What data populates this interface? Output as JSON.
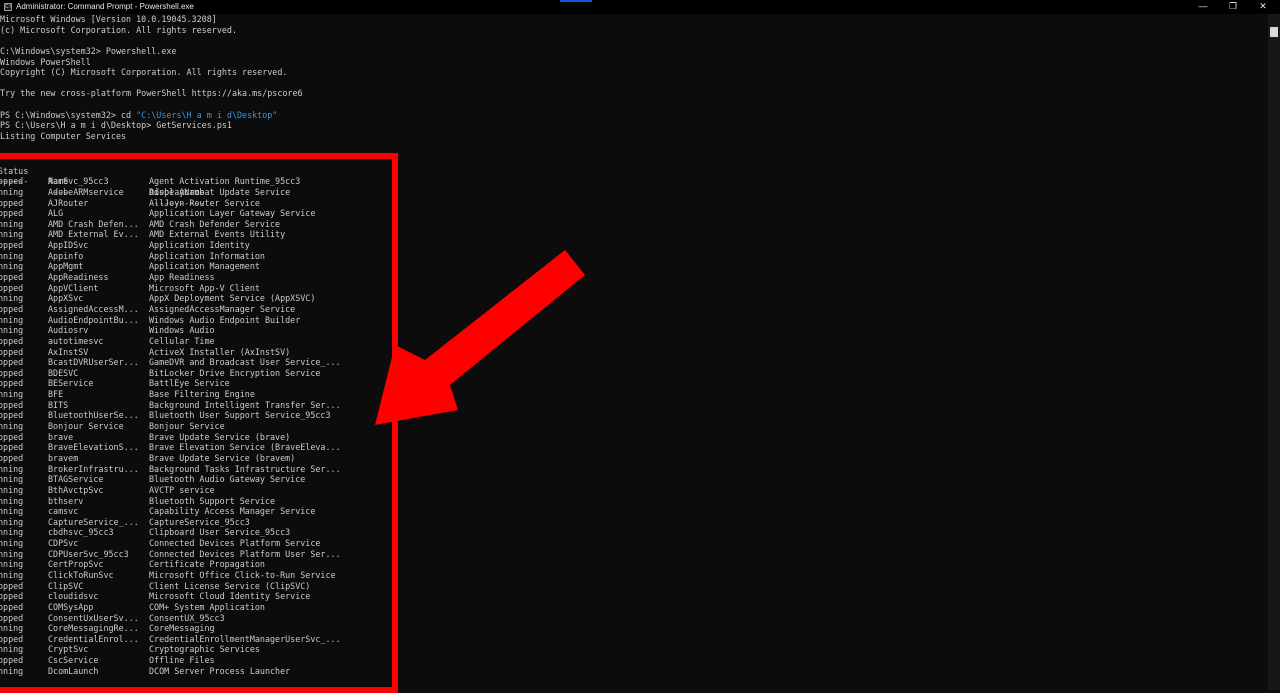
{
  "window": {
    "title": "Administrator: Command Prompt - Powershell.exe",
    "app_icon_glyph": "C:\\",
    "minimize_glyph": "—",
    "maximize_glyph": "❐",
    "close_glyph": "✕"
  },
  "terminal": {
    "lines": [
      "Microsoft Windows [Version 10.0.19045.3208]",
      "(c) Microsoft Corporation. All rights reserved.",
      "",
      "C:\\Windows\\system32> Powershell.exe",
      "Windows PowerShell",
      "Copyright (C) Microsoft Corporation. All rights reserved.",
      "",
      "Try the new cross-platform PowerShell https://aka.ms/pscore6",
      "",
      "PS C:\\Windows\\system32> cd ",
      "PS C:\\Users\\H a m i d\\Desktop> GetServices.ps1",
      "Listing Computer Services"
    ],
    "cd_path": "\"C:\\Users\\H a m i d\\Desktop\"",
    "headers": {
      "status": "Status",
      "name": "Name",
      "display": "DisplayName"
    },
    "separators": {
      "status": "------",
      "name": "----",
      "display": "-----------"
    },
    "services": [
      [
        "opped",
        "AarSvc_95cc3",
        "Agent Activation Runtime_95cc3"
      ],
      [
        "nning",
        "AdobeARMservice",
        "Adobe Acrobat Update Service"
      ],
      [
        "opped",
        "AJRouter",
        "AllJoyn Router Service"
      ],
      [
        "opped",
        "ALG",
        "Application Layer Gateway Service"
      ],
      [
        "nning",
        "AMD Crash Defen...",
        "AMD Crash Defender Service"
      ],
      [
        "nning",
        "AMD External Ev...",
        "AMD External Events Utility"
      ],
      [
        "opped",
        "AppIDSvc",
        "Application Identity"
      ],
      [
        "nning",
        "Appinfo",
        "Application Information"
      ],
      [
        "nning",
        "AppMgmt",
        "Application Management"
      ],
      [
        "opped",
        "AppReadiness",
        "App Readiness"
      ],
      [
        "opped",
        "AppVClient",
        "Microsoft App-V Client"
      ],
      [
        "nning",
        "AppXSvc",
        "AppX Deployment Service (AppXSVC)"
      ],
      [
        "opped",
        "AssignedAccessM...",
        "AssignedAccessManager Service"
      ],
      [
        "nning",
        "AudioEndpointBu...",
        "Windows Audio Endpoint Builder"
      ],
      [
        "nning",
        "Audiosrv",
        "Windows Audio"
      ],
      [
        "opped",
        "autotimesvc",
        "Cellular Time"
      ],
      [
        "opped",
        "AxInstSV",
        "ActiveX Installer (AxInstSV)"
      ],
      [
        "opped",
        "BcastDVRUserSer...",
        "GameDVR and Broadcast User Service_..."
      ],
      [
        "opped",
        "BDESVC",
        "BitLocker Drive Encryption Service"
      ],
      [
        "opped",
        "BEService",
        "BattlEye Service"
      ],
      [
        "nning",
        "BFE",
        "Base Filtering Engine"
      ],
      [
        "opped",
        "BITS",
        "Background Intelligent Transfer Ser..."
      ],
      [
        "opped",
        "BluetoothUserSe...",
        "Bluetooth User Support Service_95cc3"
      ],
      [
        "nning",
        "Bonjour Service",
        "Bonjour Service"
      ],
      [
        "opped",
        "brave",
        "Brave Update Service (brave)"
      ],
      [
        "opped",
        "BraveElevationS...",
        "Brave Elevation Service (BraveEleva..."
      ],
      [
        "opped",
        "bravem",
        "Brave Update Service (bravem)"
      ],
      [
        "nning",
        "BrokerInfrastru...",
        "Background Tasks Infrastructure Ser..."
      ],
      [
        "nning",
        "BTAGService",
        "Bluetooth Audio Gateway Service"
      ],
      [
        "nning",
        "BthAvctpSvc",
        "AVCTP service"
      ],
      [
        "nning",
        "bthserv",
        "Bluetooth Support Service"
      ],
      [
        "nning",
        "camsvc",
        "Capability Access Manager Service"
      ],
      [
        "nning",
        "CaptureService_...",
        "CaptureService_95cc3"
      ],
      [
        "nning",
        "cbdhsvc_95cc3",
        "Clipboard User Service_95cc3"
      ],
      [
        "nning",
        "CDPSvc",
        "Connected Devices Platform Service"
      ],
      [
        "nning",
        "CDPUserSvc_95cc3",
        "Connected Devices Platform User Ser..."
      ],
      [
        "nning",
        "CertPropSvc",
        "Certificate Propagation"
      ],
      [
        "nning",
        "ClickToRunSvc",
        "Microsoft Office Click-to-Run Service"
      ],
      [
        "opped",
        "ClipSVC",
        "Client License Service (ClipSVC)"
      ],
      [
        "opped",
        "cloudidsvc",
        "Microsoft Cloud Identity Service"
      ],
      [
        "opped",
        "COMSysApp",
        "COM+ System Application"
      ],
      [
        "opped",
        "ConsentUxUserSv...",
        "ConsentUX_95cc3"
      ],
      [
        "nning",
        "CoreMessagingRe...",
        "CoreMessaging"
      ],
      [
        "opped",
        "CredentialEnrol...",
        "CredentialEnrollmentManagerUserSvc_..."
      ],
      [
        "nning",
        "CryptSvc",
        "Cryptographic Services"
      ],
      [
        "opped",
        "CscService",
        "Offline Files"
      ],
      [
        "nning",
        "DcomLaunch",
        "DCOM Server Process Launcher"
      ]
    ]
  },
  "colors": {
    "terminal_bg": "#0c0c0c",
    "text": "#cccccc",
    "path_string": "#3a96dd",
    "annotation_red": "#ff0000"
  },
  "annotation": {
    "frame_color": "#ff0000",
    "arrow_icon": "red-arrow-pointing-down-left"
  }
}
